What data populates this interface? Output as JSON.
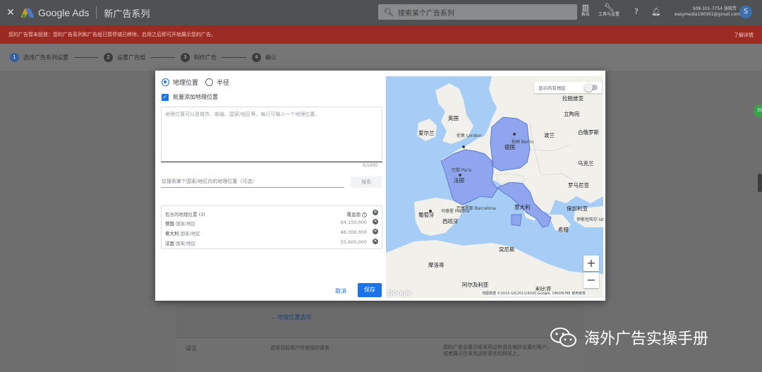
{
  "header": {
    "brand": "Google Ads",
    "campaign_title": "新广告系列",
    "search_placeholder": "搜索某个广告系列",
    "report_label": "报告",
    "tools_label": "工具与设置",
    "account_line1": "508-101-7754 张晓芳",
    "account_line2": "easymedia190301@gmail.com",
    "avatar_letter": "S"
  },
  "alert": {
    "text": "您的广告暂未投放：您的广告系列和广告组已暂停或已移除，启用之后即可开始展示您的广告。",
    "link": "了解详情"
  },
  "stepper": {
    "steps": [
      {
        "num": "1",
        "label": "选择广告系列设置"
      },
      {
        "num": "2",
        "label": "设置广告组"
      },
      {
        "num": "3",
        "label": "制作广告"
      },
      {
        "num": "4",
        "label": "确认"
      }
    ]
  },
  "dialog": {
    "radio_location": "地理位置",
    "radio_radius": "半径",
    "bulk_add_label": "批量添加地理位置",
    "textarea_placeholder": "地理位置可以是城市、邮编、国家/地区等。每行可输入一个地理位置。",
    "counter": "0/1000",
    "search_placeholder": "仅搜索某个国家/地区内的地理位置（可选）",
    "search_button": "搜索",
    "table_header": "包含的地理位置 (3)",
    "table_reach": "覆盖面",
    "rows": [
      {
        "name": "德国",
        "type": "国家/地区",
        "pop": "64,150,000"
      },
      {
        "name": "意大利",
        "type": "国家/地区",
        "pop": "46,300,000"
      },
      {
        "name": "法国",
        "type": "国家/地区",
        "pop": "55,600,000"
      }
    ],
    "cancel": "取消",
    "save": "保存"
  },
  "map": {
    "show_all": "显示所有地区",
    "zoom_in": "+",
    "zoom_out": "−",
    "footer": "地图数据 ©2019 GS(2011)6020 Google, ORION-ME  使用条款",
    "google": "Google",
    "labels": {
      "uk": "英国",
      "ireland": "爱尔兰",
      "london": "伦敦 London",
      "paris": "巴黎 Paris",
      "france": "法国",
      "germany": "德国",
      "berlin": "柏林 Berlin",
      "poland": "波兰",
      "lithuania": "立陶宛",
      "belarus": "白俄罗斯",
      "ukraine": "乌克兰",
      "romania": "罗马尼亚",
      "bulgaria": "保加利亚",
      "italy": "意大利",
      "spain": "西班牙",
      "portugal": "葡萄牙",
      "madrid": "马德里 Madrid",
      "barcelona": "巴塞罗那 Barcelona",
      "greece": "希腊",
      "morocco": "摩洛哥",
      "algeria": "阿尔及利亚",
      "libya": "利比亚",
      "tunisia": "突尼斯",
      "latvia": "拉脱维亚",
      "istanbul": "伊斯坦布尔 Istanbul"
    }
  },
  "background": {
    "language_label": "语言",
    "language_desc": "选择目标用户所使用的语言",
    "language_hint": "您的广告会展示给采用这些语言偏好设置的客户，或者展示在采用这些语言的网站上。",
    "location_options": "地理位置选项"
  },
  "side_badge": "35",
  "watermark": "海外广告实操手册"
}
